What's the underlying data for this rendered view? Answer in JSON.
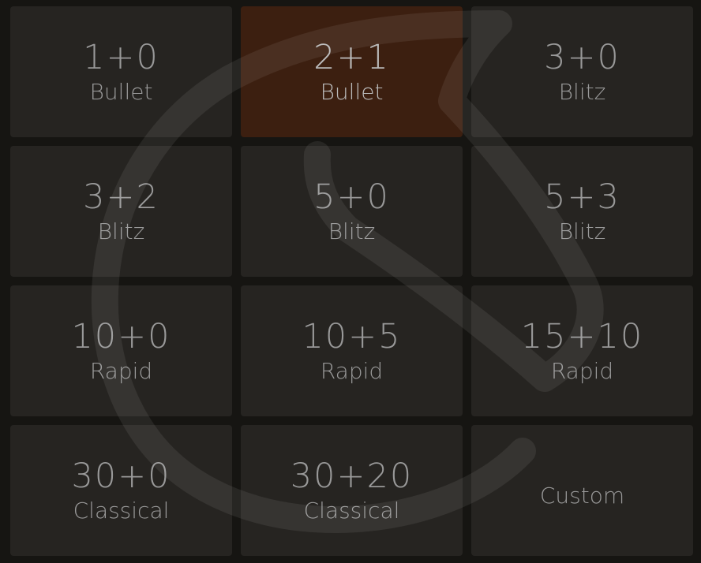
{
  "lobby": {
    "pools": [
      {
        "clock": "1+0",
        "perf": "Bullet",
        "selected": false
      },
      {
        "clock": "2+1",
        "perf": "Bullet",
        "selected": true
      },
      {
        "clock": "3+0",
        "perf": "Blitz",
        "selected": false
      },
      {
        "clock": "3+2",
        "perf": "Blitz",
        "selected": false
      },
      {
        "clock": "5+0",
        "perf": "Blitz",
        "selected": false
      },
      {
        "clock": "5+3",
        "perf": "Blitz",
        "selected": false
      },
      {
        "clock": "10+0",
        "perf": "Rapid",
        "selected": false
      },
      {
        "clock": "10+5",
        "perf": "Rapid",
        "selected": false
      },
      {
        "clock": "15+10",
        "perf": "Rapid",
        "selected": false
      },
      {
        "clock": "30+0",
        "perf": "Classical",
        "selected": false
      },
      {
        "clock": "30+20",
        "perf": "Classical",
        "selected": false
      }
    ],
    "custom_label": "Custom",
    "colors": {
      "background": "#161512",
      "tile": "#262421",
      "tile_selected": "#3c1f10",
      "text": "#999999",
      "text_selected": "#bababa"
    },
    "watermark_icon": "lichess-knight-logo-icon"
  }
}
